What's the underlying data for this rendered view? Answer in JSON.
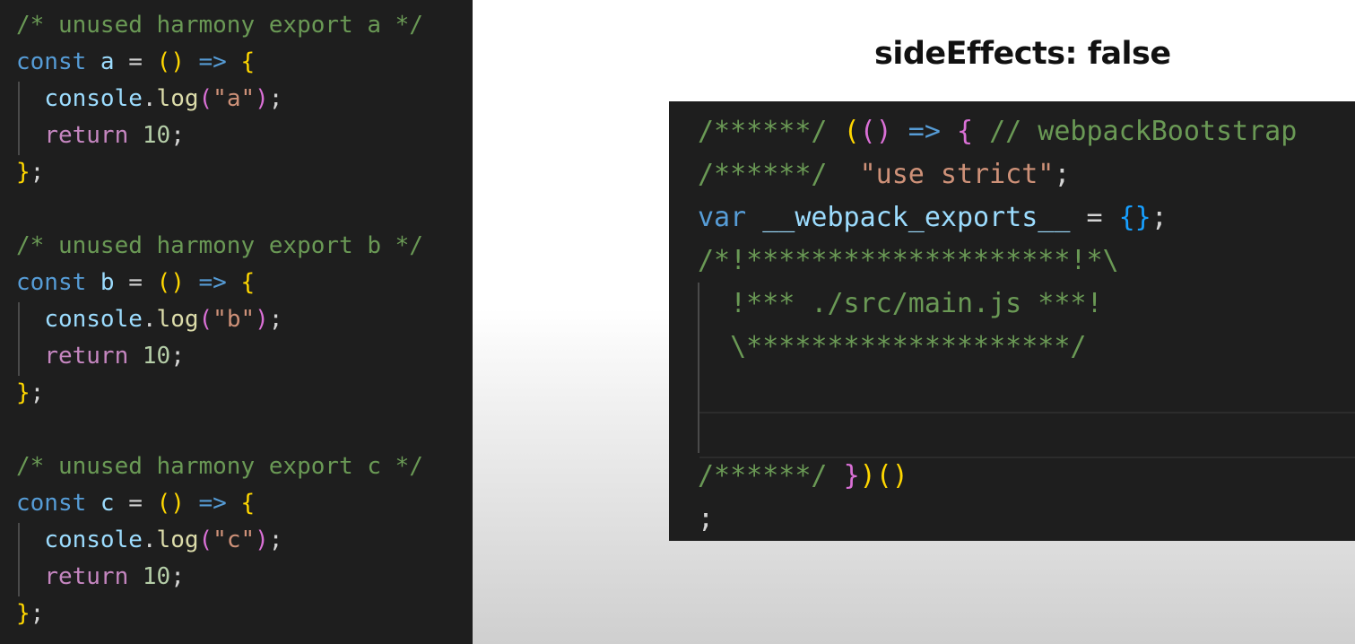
{
  "title": "sideEffects: false",
  "left_code": {
    "lines": [
      [
        {
          "t": "/* unused harmony export a */",
          "c": "comment"
        }
      ],
      [
        {
          "t": "const",
          "c": "kw"
        },
        {
          "t": " a ",
          "c": "var"
        },
        {
          "t": "= ",
          "c": "plain"
        },
        {
          "t": "()",
          "c": "b1"
        },
        {
          "t": " => ",
          "c": "op"
        },
        {
          "t": "{",
          "c": "b1"
        }
      ],
      [
        {
          "t": "  ",
          "c": "plain"
        },
        {
          "t": "console",
          "c": "var"
        },
        {
          "t": ".",
          "c": "plain"
        },
        {
          "t": "log",
          "c": "fn"
        },
        {
          "t": "(",
          "c": "b2"
        },
        {
          "t": "\"a\"",
          "c": "str"
        },
        {
          "t": ")",
          "c": "b2"
        },
        {
          "t": ";",
          "c": "plain"
        }
      ],
      [
        {
          "t": "  ",
          "c": "plain"
        },
        {
          "t": "return",
          "c": "ctrl"
        },
        {
          "t": " ",
          "c": "plain"
        },
        {
          "t": "10",
          "c": "num"
        },
        {
          "t": ";",
          "c": "plain"
        }
      ],
      [
        {
          "t": "}",
          "c": "b1"
        },
        {
          "t": ";",
          "c": "plain"
        }
      ],
      [],
      [
        {
          "t": "/* unused harmony export b */",
          "c": "comment"
        }
      ],
      [
        {
          "t": "const",
          "c": "kw"
        },
        {
          "t": " b ",
          "c": "var"
        },
        {
          "t": "= ",
          "c": "plain"
        },
        {
          "t": "()",
          "c": "b1"
        },
        {
          "t": " => ",
          "c": "op"
        },
        {
          "t": "{",
          "c": "b1"
        }
      ],
      [
        {
          "t": "  ",
          "c": "plain"
        },
        {
          "t": "console",
          "c": "var"
        },
        {
          "t": ".",
          "c": "plain"
        },
        {
          "t": "log",
          "c": "fn"
        },
        {
          "t": "(",
          "c": "b2"
        },
        {
          "t": "\"b\"",
          "c": "str"
        },
        {
          "t": ")",
          "c": "b2"
        },
        {
          "t": ";",
          "c": "plain"
        }
      ],
      [
        {
          "t": "  ",
          "c": "plain"
        },
        {
          "t": "return",
          "c": "ctrl"
        },
        {
          "t": " ",
          "c": "plain"
        },
        {
          "t": "10",
          "c": "num"
        },
        {
          "t": ";",
          "c": "plain"
        }
      ],
      [
        {
          "t": "}",
          "c": "b1"
        },
        {
          "t": ";",
          "c": "plain"
        }
      ],
      [],
      [
        {
          "t": "/* unused harmony export c */",
          "c": "comment"
        }
      ],
      [
        {
          "t": "const",
          "c": "kw"
        },
        {
          "t": " c ",
          "c": "var"
        },
        {
          "t": "= ",
          "c": "plain"
        },
        {
          "t": "()",
          "c": "b1"
        },
        {
          "t": " => ",
          "c": "op"
        },
        {
          "t": "{",
          "c": "b1"
        }
      ],
      [
        {
          "t": "  ",
          "c": "plain"
        },
        {
          "t": "console",
          "c": "var"
        },
        {
          "t": ".",
          "c": "plain"
        },
        {
          "t": "log",
          "c": "fn"
        },
        {
          "t": "(",
          "c": "b2"
        },
        {
          "t": "\"c\"",
          "c": "str"
        },
        {
          "t": ")",
          "c": "b2"
        },
        {
          "t": ";",
          "c": "plain"
        }
      ],
      [
        {
          "t": "  ",
          "c": "plain"
        },
        {
          "t": "return",
          "c": "ctrl"
        },
        {
          "t": " ",
          "c": "plain"
        },
        {
          "t": "10",
          "c": "num"
        },
        {
          "t": ";",
          "c": "plain"
        }
      ],
      [
        {
          "t": "}",
          "c": "b1"
        },
        {
          "t": ";",
          "c": "plain"
        }
      ]
    ]
  },
  "right_code": {
    "lines": [
      [
        {
          "t": "/******/ ",
          "c": "comment"
        },
        {
          "t": "(",
          "c": "b1"
        },
        {
          "t": "()",
          "c": "b2"
        },
        {
          "t": " => ",
          "c": "op"
        },
        {
          "t": "{",
          "c": "b2"
        },
        {
          "t": " // webpackBootstrap",
          "c": "comment"
        }
      ],
      [
        {
          "t": "/******/  ",
          "c": "comment"
        },
        {
          "t": "\"use strict\"",
          "c": "str"
        },
        {
          "t": ";",
          "c": "plain"
        }
      ],
      [
        {
          "t": "var",
          "c": "kw"
        },
        {
          "t": " __webpack_exports__ ",
          "c": "var"
        },
        {
          "t": "= ",
          "c": "plain"
        },
        {
          "t": "{}",
          "c": "b3"
        },
        {
          "t": ";",
          "c": "plain"
        }
      ],
      [
        {
          "t": "/*!********************!*\\",
          "c": "comment"
        }
      ],
      [
        {
          "t": "  !*** ./src/main.js ***!",
          "c": "comment"
        }
      ],
      [
        {
          "t": "  \\********************/",
          "c": "comment"
        }
      ],
      [],
      [],
      [
        {
          "t": "/******/ ",
          "c": "comment"
        },
        {
          "t": "}",
          "c": "b2"
        },
        {
          "t": ")",
          "c": "b1"
        },
        {
          "t": "()",
          "c": "b1"
        }
      ],
      [
        {
          "t": ";",
          "c": "plain"
        }
      ]
    ]
  }
}
